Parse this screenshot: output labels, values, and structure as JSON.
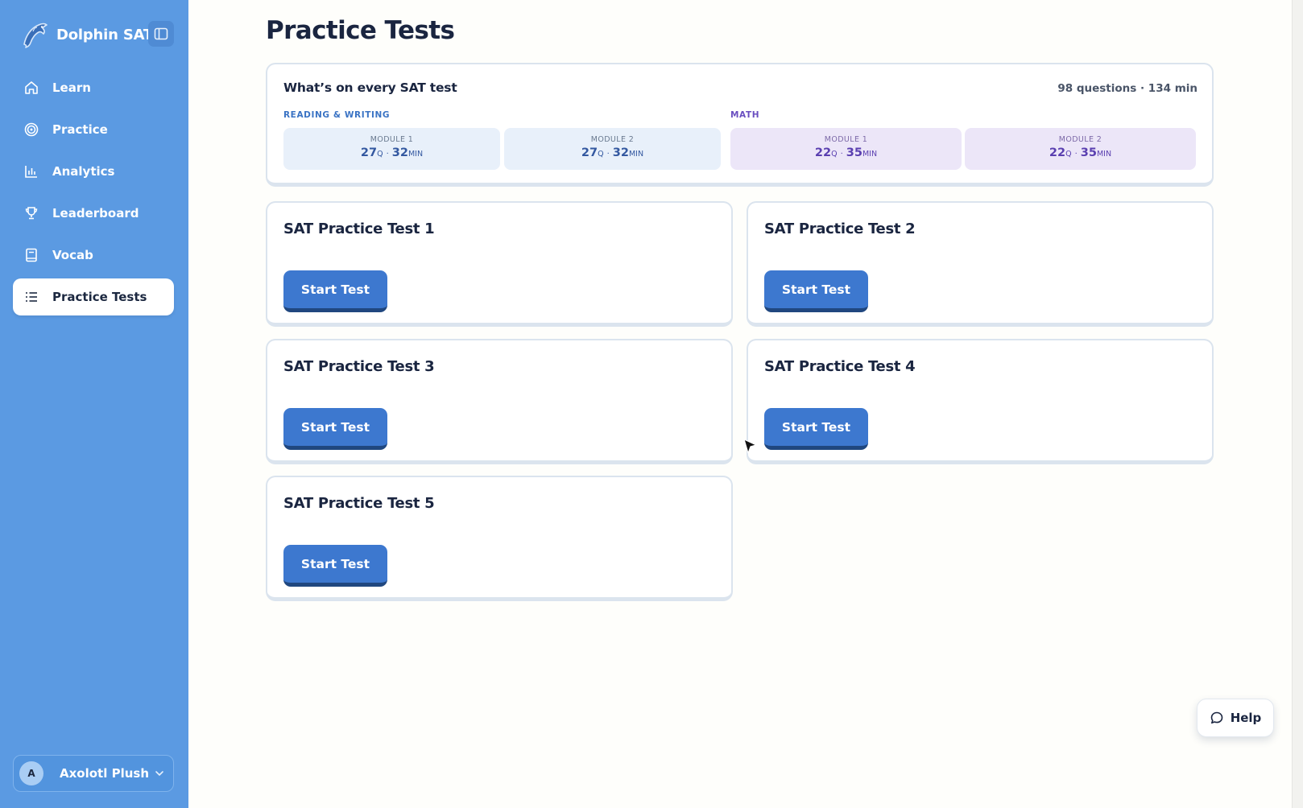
{
  "app": {
    "name": "Dolphin SAT",
    "page_title": "Practice Tests"
  },
  "sidebar": {
    "items": [
      {
        "label": "Learn",
        "icon": "home-icon"
      },
      {
        "label": "Practice",
        "icon": "target-icon"
      },
      {
        "label": "Analytics",
        "icon": "bar-chart-icon"
      },
      {
        "label": "Leaderboard",
        "icon": "trophy-icon"
      },
      {
        "label": "Vocab",
        "icon": "book-icon"
      },
      {
        "label": "Practice Tests",
        "icon": "list-icon",
        "active": true
      }
    ],
    "user": {
      "initial": "A",
      "name": "Axolotl Plush"
    }
  },
  "overview": {
    "title": "What’s on every SAT test",
    "summary": "98 questions · 134 min",
    "sections": [
      {
        "label": "READING & WRITING",
        "modules": [
          {
            "label": "MODULE 1",
            "questions": "27",
            "q_unit": "Q",
            "minutes": "32",
            "min_unit": "MIN"
          },
          {
            "label": "MODULE 2",
            "questions": "27",
            "q_unit": "Q",
            "minutes": "32",
            "min_unit": "MIN"
          }
        ]
      },
      {
        "label": "MATH",
        "modules": [
          {
            "label": "MODULE 1",
            "questions": "22",
            "q_unit": "Q",
            "minutes": "35",
            "min_unit": "MIN"
          },
          {
            "label": "MODULE 2",
            "questions": "22",
            "q_unit": "Q",
            "minutes": "35",
            "min_unit": "MIN"
          }
        ]
      }
    ],
    "separator": "·"
  },
  "tests": [
    {
      "title": "SAT Practice Test 1",
      "button": "Start Test"
    },
    {
      "title": "SAT Practice Test 2",
      "button": "Start Test"
    },
    {
      "title": "SAT Practice Test 3",
      "button": "Start Test"
    },
    {
      "title": "SAT Practice Test 4",
      "button": "Start Test"
    },
    {
      "title": "SAT Practice Test 5",
      "button": "Start Test"
    }
  ],
  "help": {
    "label": "Help"
  },
  "colors": {
    "sidebar_bg": "#5b9ae2",
    "primary_button": "#3d78cf",
    "reading_accent": "#3a73c4",
    "math_accent": "#6a4fc0"
  }
}
